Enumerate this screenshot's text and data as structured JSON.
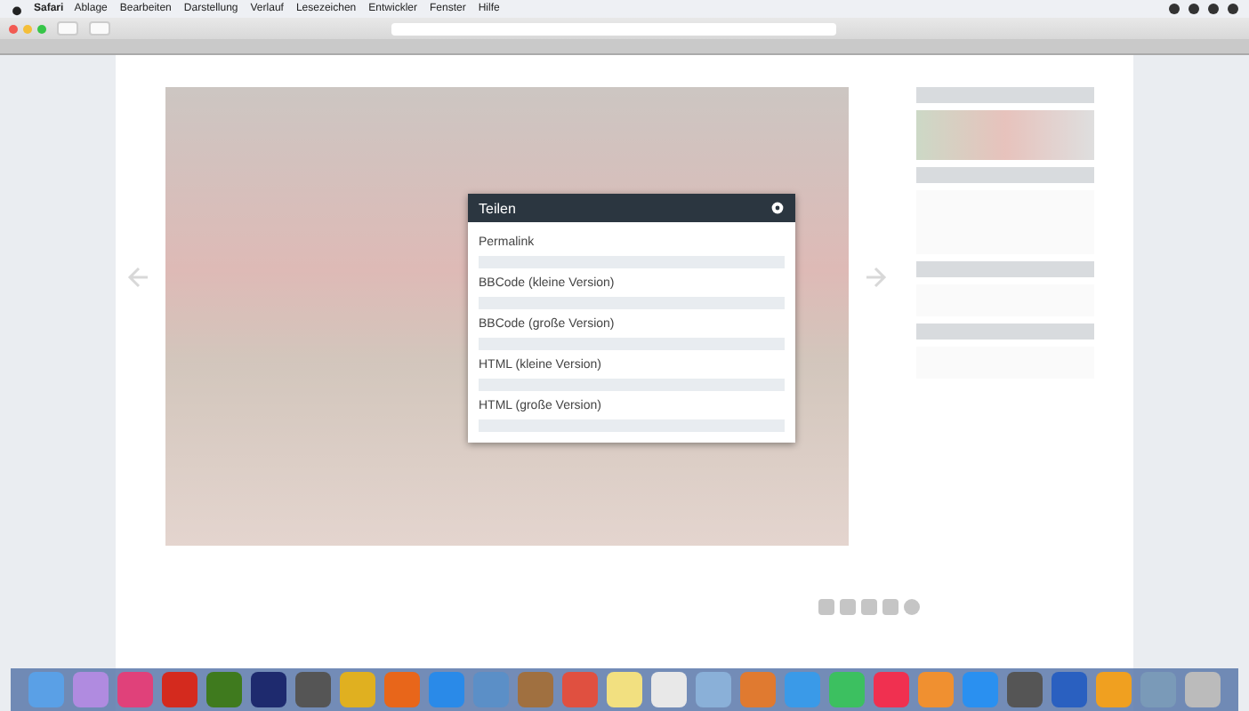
{
  "menu_bar": {
    "app": "Safari",
    "items": [
      "Ablage",
      "Bearbeiten",
      "Darstellung",
      "Verlauf",
      "Lesezeichen",
      "Entwickler",
      "Fenster",
      "Hilfe"
    ]
  },
  "share_dialog": {
    "title": "Teilen",
    "fields": [
      {
        "label": "Permalink"
      },
      {
        "label": "BBCode (kleine Version)"
      },
      {
        "label": "BBCode (große Version)"
      },
      {
        "label": "HTML (kleine Version)"
      },
      {
        "label": "HTML (große Version)"
      }
    ]
  }
}
